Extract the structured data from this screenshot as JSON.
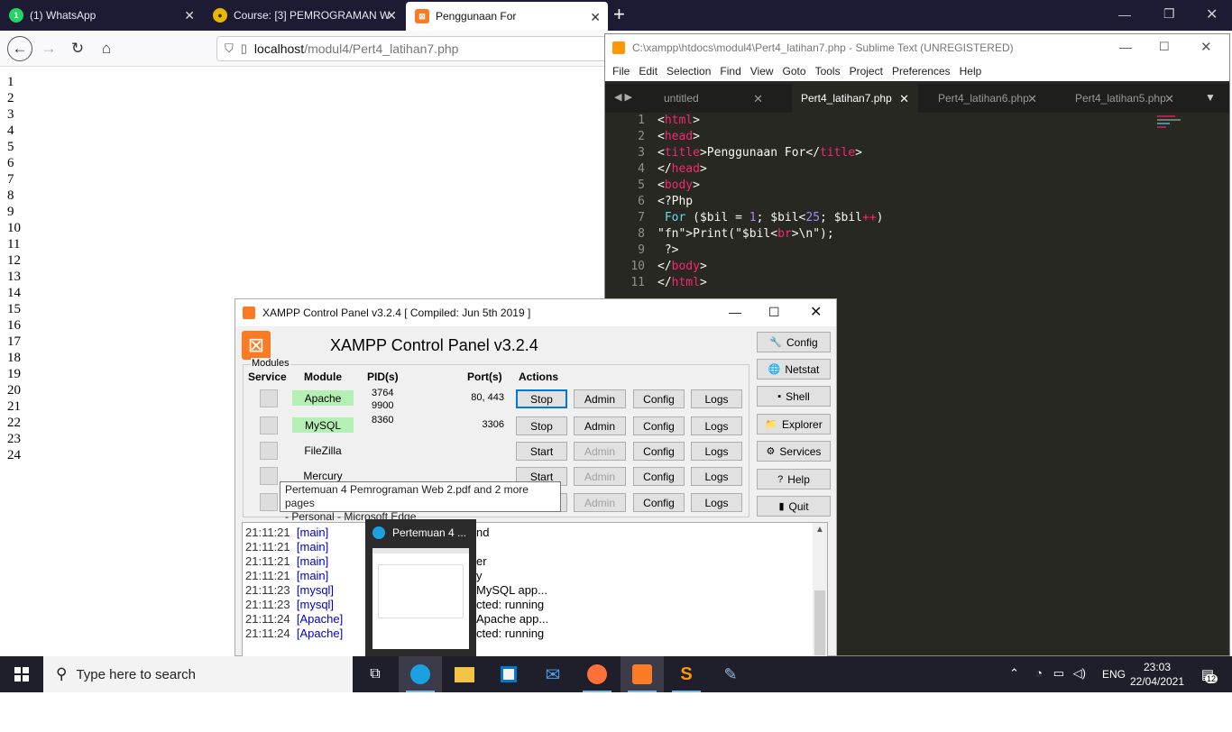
{
  "browser": {
    "tabs": [
      {
        "label": "(1) WhatsApp"
      },
      {
        "label": "Course: [3] PEMROGRAMAN W"
      },
      {
        "label": "Penggunaan For"
      }
    ],
    "url_host": "localhost",
    "url_path": "/modul4/Pert4_latihan7.php",
    "new_tab_symbol": "+",
    "page_output": [
      "1",
      "2",
      "3",
      "4",
      "5",
      "6",
      "7",
      "8",
      "9",
      "10",
      "11",
      "12",
      "13",
      "14",
      "15",
      "16",
      "17",
      "18",
      "19",
      "20",
      "21",
      "22",
      "23",
      "24"
    ]
  },
  "sublime": {
    "title": "C:\\xampp\\htdocs\\modul4\\Pert4_latihan7.php - Sublime Text (UNREGISTERED)",
    "menu": [
      "File",
      "Edit",
      "Selection",
      "Find",
      "View",
      "Goto",
      "Tools",
      "Project",
      "Preferences",
      "Help"
    ],
    "tabs": [
      "untitled",
      "Pert4_latihan7.php",
      "Pert4_latihan6.php",
      "Pert4_latihan5.php"
    ],
    "line_numbers": [
      "1",
      "2",
      "3",
      "4",
      "5",
      "6",
      "7",
      "8",
      "9",
      "10",
      "11"
    ],
    "code_lines": [
      "<html>",
      "<head>",
      "<title>Penggunaan For</title>",
      "</head>",
      "<body>",
      "<?Php",
      " For ($bil = 1; $bil<25; $bil++)",
      "Print(\"$bil<br>\\n\");",
      " ?>",
      "</body>",
      "</html>"
    ]
  },
  "xampp": {
    "title": "XAMPP Control Panel v3.2.4   [ Compiled: Jun 5th 2019 ]",
    "heading": "XAMPP Control Panel v3.2.4",
    "modules_label": "Modules",
    "headers": {
      "service": "Service",
      "module": "Module",
      "pids": "PID(s)",
      "ports": "Port(s)",
      "actions": "Actions"
    },
    "rows": [
      {
        "module": "Apache",
        "pid": "3764\n9900",
        "ports": "80, 443",
        "action": "Stop",
        "running": true
      },
      {
        "module": "MySQL",
        "pid": "8360",
        "ports": "3306",
        "action": "Stop",
        "running": true
      },
      {
        "module": "FileZilla",
        "pid": "",
        "ports": "",
        "action": "Start",
        "running": false
      },
      {
        "module": "Mercury",
        "pid": "",
        "ports": "",
        "action": "Start",
        "running": false
      },
      {
        "module": "",
        "pid": "",
        "ports": "",
        "action": "Start",
        "running": false
      }
    ],
    "btn_admin": "Admin",
    "btn_config": "Config",
    "btn_logs": "Logs",
    "side_buttons": [
      "Config",
      "Netstat",
      "Shell",
      "Explorer",
      "Services",
      "Help",
      "Quit"
    ],
    "log": [
      {
        "time": "21:11:21",
        "src": "[main]",
        "msg": "nd"
      },
      {
        "time": "21:11:21",
        "src": "[main]",
        "msg": ""
      },
      {
        "time": "21:11:21",
        "src": "[main]",
        "msg": "er"
      },
      {
        "time": "21:11:21",
        "src": "[main]",
        "msg": "y"
      },
      {
        "time": "21:11:23",
        "src": "[mysql]",
        "msg": "MySQL app..."
      },
      {
        "time": "21:11:23",
        "src": "[mysql]",
        "msg": "cted: running"
      },
      {
        "time": "21:11:24",
        "src": "[Apache]",
        "msg": "Apache app..."
      },
      {
        "time": "21:11:24",
        "src": "[Apache]",
        "msg": "cted: running"
      }
    ]
  },
  "tooltip": {
    "line1": "Pertemuan 4 Pemrograman Web 2.pdf and 2 more pages",
    "line2": "- Personal - Microsoft Edge"
  },
  "thumbnail": {
    "title": "Pertemuan 4 ..."
  },
  "taskbar": {
    "search_placeholder": "Type here to search",
    "language": "ENG",
    "time": "23:03",
    "date": "22/04/2021",
    "notifications": "12"
  }
}
